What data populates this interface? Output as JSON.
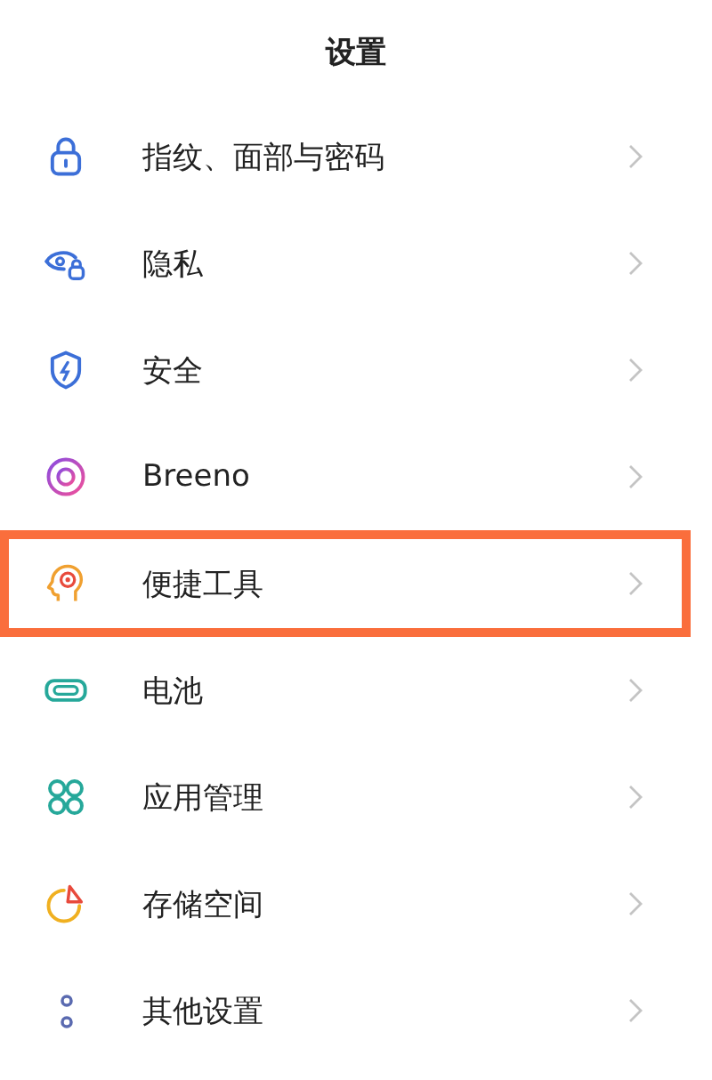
{
  "header": {
    "title": "设置"
  },
  "items": [
    {
      "label": "指纹、面部与密码",
      "highlighted": false
    },
    {
      "label": "隐私",
      "highlighted": false
    },
    {
      "label": "安全",
      "highlighted": false
    },
    {
      "label": "Breeno",
      "highlighted": false
    },
    {
      "label": "便捷工具",
      "highlighted": true
    },
    {
      "label": "电池",
      "highlighted": false
    },
    {
      "label": "应用管理",
      "highlighted": false
    },
    {
      "label": "存储空间",
      "highlighted": false
    },
    {
      "label": "其他设置",
      "highlighted": false
    }
  ]
}
